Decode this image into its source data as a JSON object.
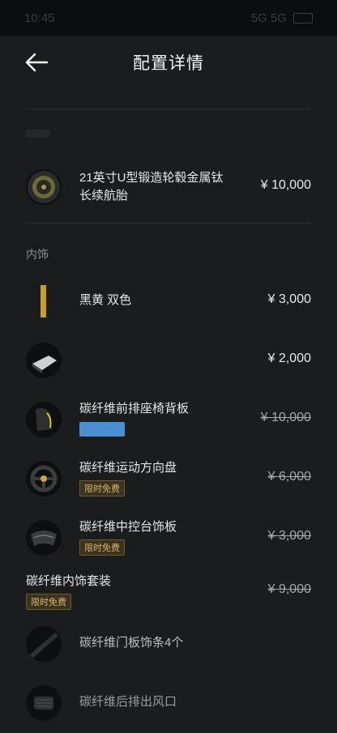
{
  "status": {
    "time": "10:45",
    "signal": "5G 5G"
  },
  "header": {
    "title": "配置详情"
  },
  "wheels": {
    "name": "21英寸U型锻造轮毂金属钛\n长续航胎",
    "price": "¥ 10,000"
  },
  "interior": {
    "label": "内饰",
    "items": [
      {
        "name": "黑黄 双色",
        "price": "¥ 3,000",
        "struck": false
      },
      {
        "name": "",
        "price": "¥ 2,000",
        "struck": false
      },
      {
        "name": "碳纤维前排座椅背板",
        "price": "¥ 10,000",
        "struck": true,
        "chip": "#4a8fd2"
      },
      {
        "name": "碳纤维运动方向盘",
        "price": "¥ 6,000",
        "struck": true,
        "badge": "限时免费"
      },
      {
        "name": "碳纤维中控台饰板",
        "price": "¥ 3,000",
        "struck": true,
        "badge": "限时免费"
      }
    ]
  },
  "package": {
    "name": "碳纤维内饰套装",
    "price": "¥ 9,000",
    "badge": "限时免费"
  },
  "package_items": [
    {
      "name": "碳纤维门板饰条4个"
    },
    {
      "name": "碳纤维后排出风口"
    }
  ],
  "icons": [
    "back-arrow-icon",
    "wheel-icon",
    "color-swatch-icon",
    "armrest-icon",
    "seat-icon",
    "steering-wheel-icon",
    "console-icon",
    "door-trim-icon",
    "vent-icon"
  ]
}
